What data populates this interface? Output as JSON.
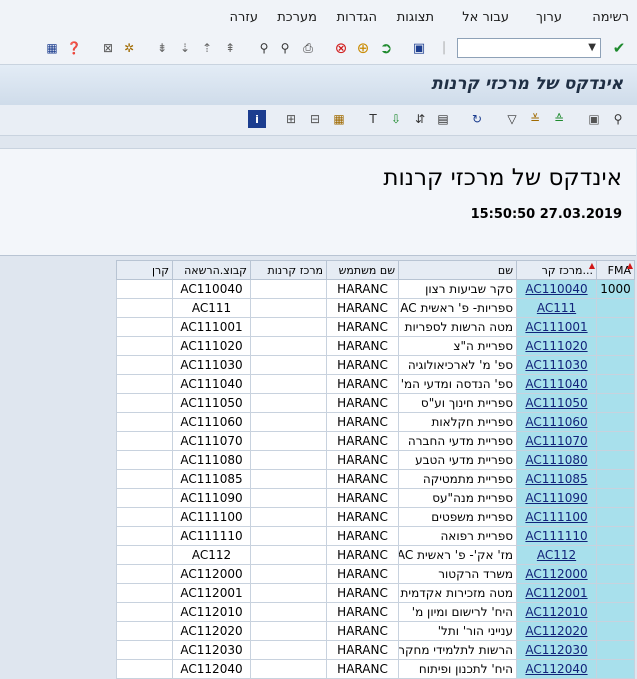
{
  "menu": [
    {
      "id": "list",
      "label": "רשימה"
    },
    {
      "id": "edit",
      "label": "ערוך"
    },
    {
      "id": "goto",
      "label": "עבור אל"
    },
    {
      "id": "views",
      "label": "תצוגות"
    },
    {
      "id": "settings",
      "label": "הגדרות"
    },
    {
      "id": "system",
      "label": "מערכת"
    },
    {
      "id": "help",
      "label": "עזרה"
    }
  ],
  "command_field": {
    "value": "",
    "placeholder": ""
  },
  "title": "אינדקס של מרכזי קרנות",
  "report": {
    "heading": "אינדקס של מרכזי קרנות",
    "datetime": "15:50:50 27.03.2019"
  },
  "columns": {
    "fma": "FMA",
    "center": "מרכז קר...",
    "name": "שם",
    "user": "שם משתמש",
    "profit_center": "מרכז קרנות",
    "group": "קבוצ.הרשאה",
    "fund": "קרן"
  },
  "fma_value": "1000",
  "rows": [
    {
      "center": "AC110040",
      "name": "סקר שביעות רצון",
      "user": "HARANC",
      "group": "AC110040"
    },
    {
      "center": "AC111",
      "name": "ספריות- פ' ראשית AC",
      "user": "HARANC",
      "group": "AC111"
    },
    {
      "center": "AC111001",
      "name": "מטה הרשות לספריות",
      "user": "HARANC",
      "group": "AC111001"
    },
    {
      "center": "AC111020",
      "name": "ספריית ה\"צ",
      "user": "HARANC",
      "group": "AC111020"
    },
    {
      "center": "AC111030",
      "name": "ספ' מ' לארכיאולוגיה",
      "user": "HARANC",
      "group": "AC111030"
    },
    {
      "center": "AC111040",
      "name": "ספ' הנדסה ומדעי המ'",
      "user": "HARANC",
      "group": "AC111040"
    },
    {
      "center": "AC111050",
      "name": "ספריית חינוך וע\"ס",
      "user": "HARANC",
      "group": "AC111050"
    },
    {
      "center": "AC111060",
      "name": "ספריית חקלאות",
      "user": "HARANC",
      "group": "AC111060"
    },
    {
      "center": "AC111070",
      "name": "ספריית מדעי החברה",
      "user": "HARANC",
      "group": "AC111070"
    },
    {
      "center": "AC111080",
      "name": "ספריית מדעי הטבע",
      "user": "HARANC",
      "group": "AC111080"
    },
    {
      "center": "AC111085",
      "name": "ספריית מתמטיקה",
      "user": "HARANC",
      "group": "AC111085"
    },
    {
      "center": "AC111090",
      "name": "ספריית מנה\"עס",
      "user": "HARANC",
      "group": "AC111090"
    },
    {
      "center": "AC111100",
      "name": "ספריית משפטים",
      "user": "HARANC",
      "group": "AC111100"
    },
    {
      "center": "AC111110",
      "name": "ספריית רפואה",
      "user": "HARANC",
      "group": "AC111110"
    },
    {
      "center": "AC112",
      "name": "מז' אק'- פ' ראשית AC",
      "user": "HARANC",
      "group": "AC112"
    },
    {
      "center": "AC112000",
      "name": "משרד הרקטור",
      "user": "HARANC",
      "group": "AC112000"
    },
    {
      "center": "AC112001",
      "name": "מטה מזכירות אקדמית",
      "user": "HARANC",
      "group": "AC112001"
    },
    {
      "center": "AC112010",
      "name": "היח' לרישום ומיון מ'",
      "user": "HARANC",
      "group": "AC112010"
    },
    {
      "center": "AC112020",
      "name": "ענייני הור' ותל'",
      "user": "HARANC",
      "group": "AC112020"
    },
    {
      "center": "AC112030",
      "name": "הרשות לתלמידי מחקר",
      "user": "HARANC",
      "group": "AC112030"
    },
    {
      "center": "AC112040",
      "name": "היח' לתכנון ופיתוח",
      "user": "HARANC",
      "group": "AC112040"
    }
  ]
}
